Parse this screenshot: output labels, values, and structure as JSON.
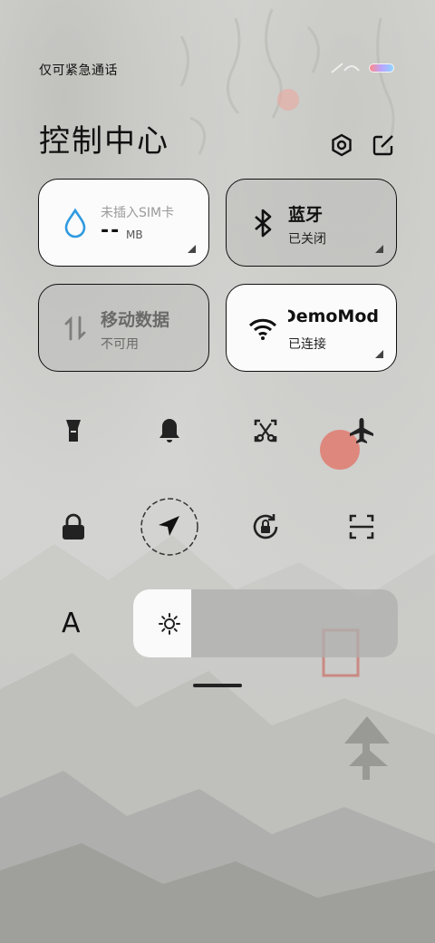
{
  "status_bar": {
    "carrier_text": "仅可紧急通话",
    "battery_icon": "battery-icon"
  },
  "header": {
    "title": "控制中心",
    "settings_icon": "settings-hexagon-icon",
    "edit_icon": "edit-icon"
  },
  "tiles": {
    "data_usage": {
      "sim_text": "未插入SIM卡",
      "value": "--",
      "unit": "MB",
      "icon": "water-drop-icon",
      "state": "on"
    },
    "bluetooth": {
      "title": "蓝牙",
      "status": "已关闭",
      "icon": "bluetooth-icon",
      "state": "off"
    },
    "mobile_data": {
      "title": "移动数据",
      "status": "不可用",
      "icon": "data-arrows-icon",
      "state": "off"
    },
    "wifi": {
      "title": "DemoMod",
      "status": "已连接",
      "icon": "wifi-icon",
      "state": "on"
    }
  },
  "toggles_row1": [
    "flashlight-icon",
    "bell-icon",
    "screenshot-icon",
    "airplane-icon"
  ],
  "toggles_row2": [
    "lock-icon",
    "location-icon",
    "rotation-lock-icon",
    "scan-icon"
  ],
  "font_size_label": "A",
  "brightness": {
    "icon": "sun-icon",
    "level_percent": 22
  },
  "colors": {
    "tile_on": "#fbfbfb",
    "accent_blue": "#2f9ae0",
    "text": "#111111"
  }
}
